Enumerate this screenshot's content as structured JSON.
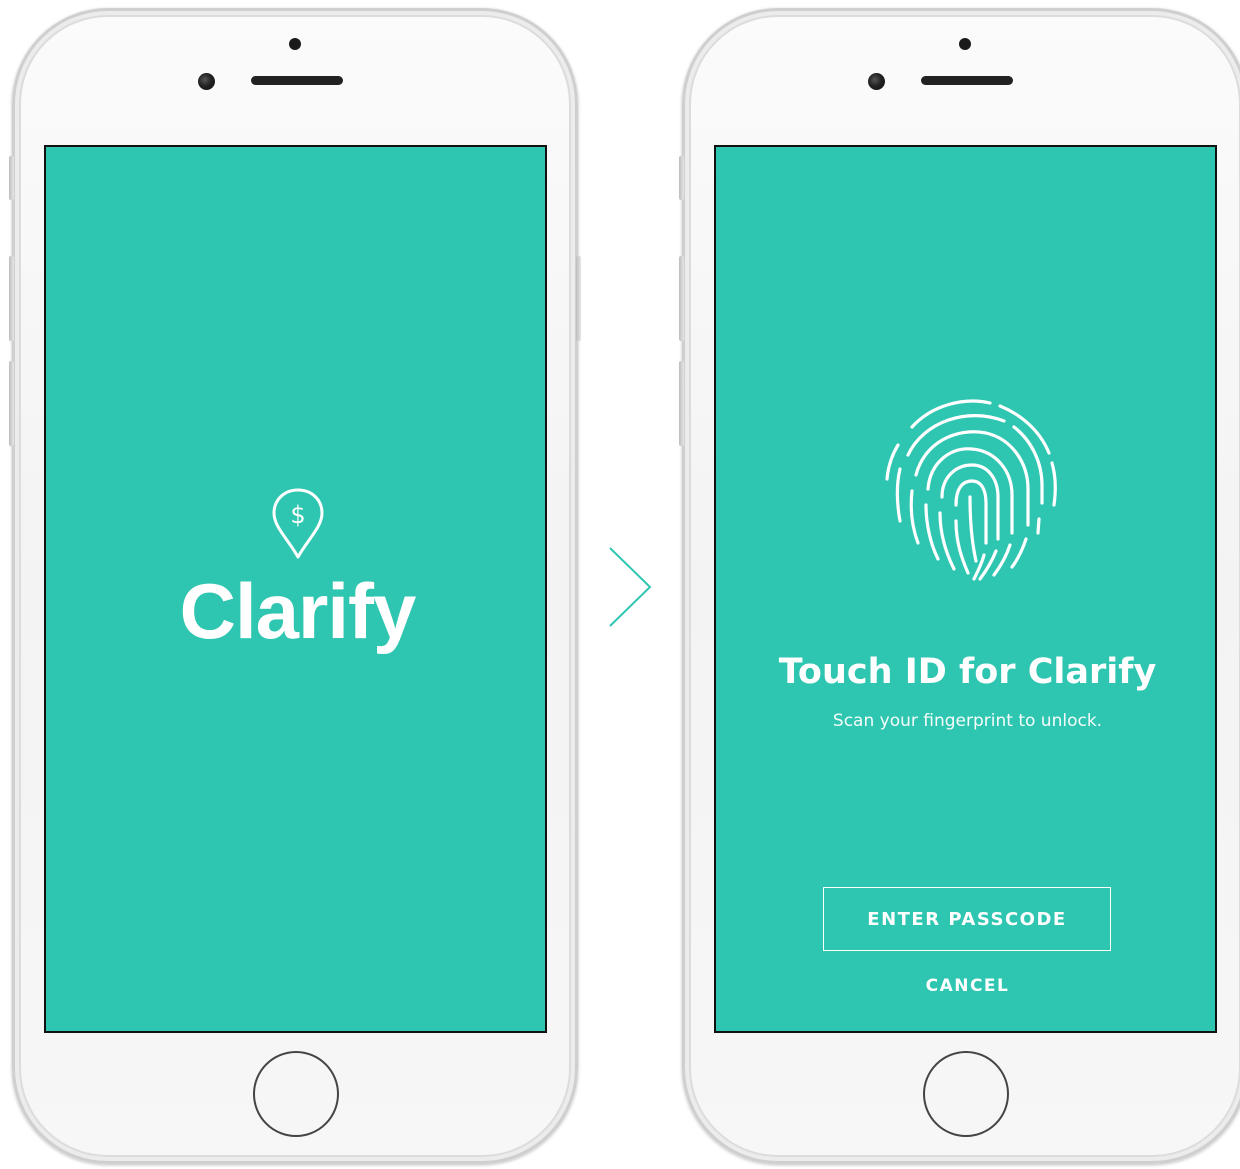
{
  "colors": {
    "screen_background": "#2fc6b1",
    "foreground": "#ffffff",
    "arrow": "#2fc6b1"
  },
  "splash_screen": {
    "logo_icon": "map-pin-dollar-icon",
    "logo_symbol": "$",
    "brand_name": "Clarify"
  },
  "transition": {
    "icon": "chevron-right-icon"
  },
  "touch_id_screen": {
    "icon": "fingerprint-icon",
    "title": "Touch ID for Clarify",
    "subtitle": "Scan your fingerprint to unlock.",
    "enter_passcode_label": "ENTER PASSCODE",
    "cancel_label": "CANCEL"
  }
}
